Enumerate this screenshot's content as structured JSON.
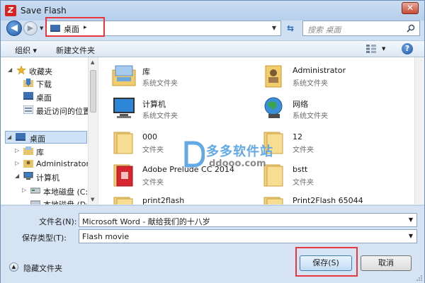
{
  "window": {
    "title": "Save Flash",
    "app_icon_letter": "Z",
    "close_label": "✕"
  },
  "address_bar": {
    "location": "桌面",
    "arrow": "▸"
  },
  "search": {
    "placeholder": "搜索 桌面"
  },
  "toolbar": {
    "organize_label": "组织 ▾",
    "new_folder_label": "新建文件夹"
  },
  "nav": {
    "items": [
      {
        "label": "收藏夹",
        "icon": "star-icon"
      },
      {
        "label": "下载",
        "icon": "download-folder-icon"
      },
      {
        "label": "桌面",
        "icon": "desktop-icon"
      },
      {
        "label": "最近访问的位置",
        "icon": "recent-places-icon"
      },
      {
        "label": "桌面",
        "icon": "desktop-icon",
        "selected": true
      },
      {
        "label": "库",
        "icon": "library-icon"
      },
      {
        "label": "Administrator",
        "icon": "user-folder-icon"
      },
      {
        "label": "计算机",
        "icon": "computer-icon"
      },
      {
        "label": "本地磁盘 (C:)",
        "icon": "drive-icon"
      },
      {
        "label": "本地磁盘 (D:)",
        "icon": "drive-icon"
      }
    ]
  },
  "files": [
    {
      "name": "库",
      "type": "系统文件夹",
      "icon": "library-folder-icon"
    },
    {
      "name": "Administrator",
      "type": "系统文件夹",
      "icon": "user-folder-icon"
    },
    {
      "name": "计算机",
      "type": "系统文件夹",
      "icon": "computer-icon"
    },
    {
      "name": "网络",
      "type": "系统文件夹",
      "icon": "network-globe-icon"
    },
    {
      "name": "000",
      "type": "文件夹",
      "icon": "folder-icon"
    },
    {
      "name": "12",
      "type": "文件夹",
      "icon": "folder-icon"
    },
    {
      "name": "Adobe Prelude CC 2014",
      "type": "文件夹",
      "icon": "adobe-folder-icon"
    },
    {
      "name": "bstt",
      "type": "文件夹",
      "icon": "folder-icon"
    },
    {
      "name": "print2flash",
      "type": "",
      "icon": "folder-icon"
    },
    {
      "name": "Print2Flash 65044",
      "type": "",
      "icon": "folder-icon"
    }
  ],
  "watermark": {
    "text": "多多软件站",
    "url": "ddooo.com"
  },
  "form": {
    "filename_label": "文件名(N):",
    "filename_value": "Microsoft Word - 献给我们的十八岁",
    "filetype_label": "保存类型(T):",
    "filetype_value": "Flash movie",
    "hide_folders_label": "隐藏文件夹",
    "save_label": "保存(S)",
    "cancel_label": "取消"
  },
  "colors": {
    "highlight": "#e8373f",
    "accent": "#1f5aa6"
  }
}
